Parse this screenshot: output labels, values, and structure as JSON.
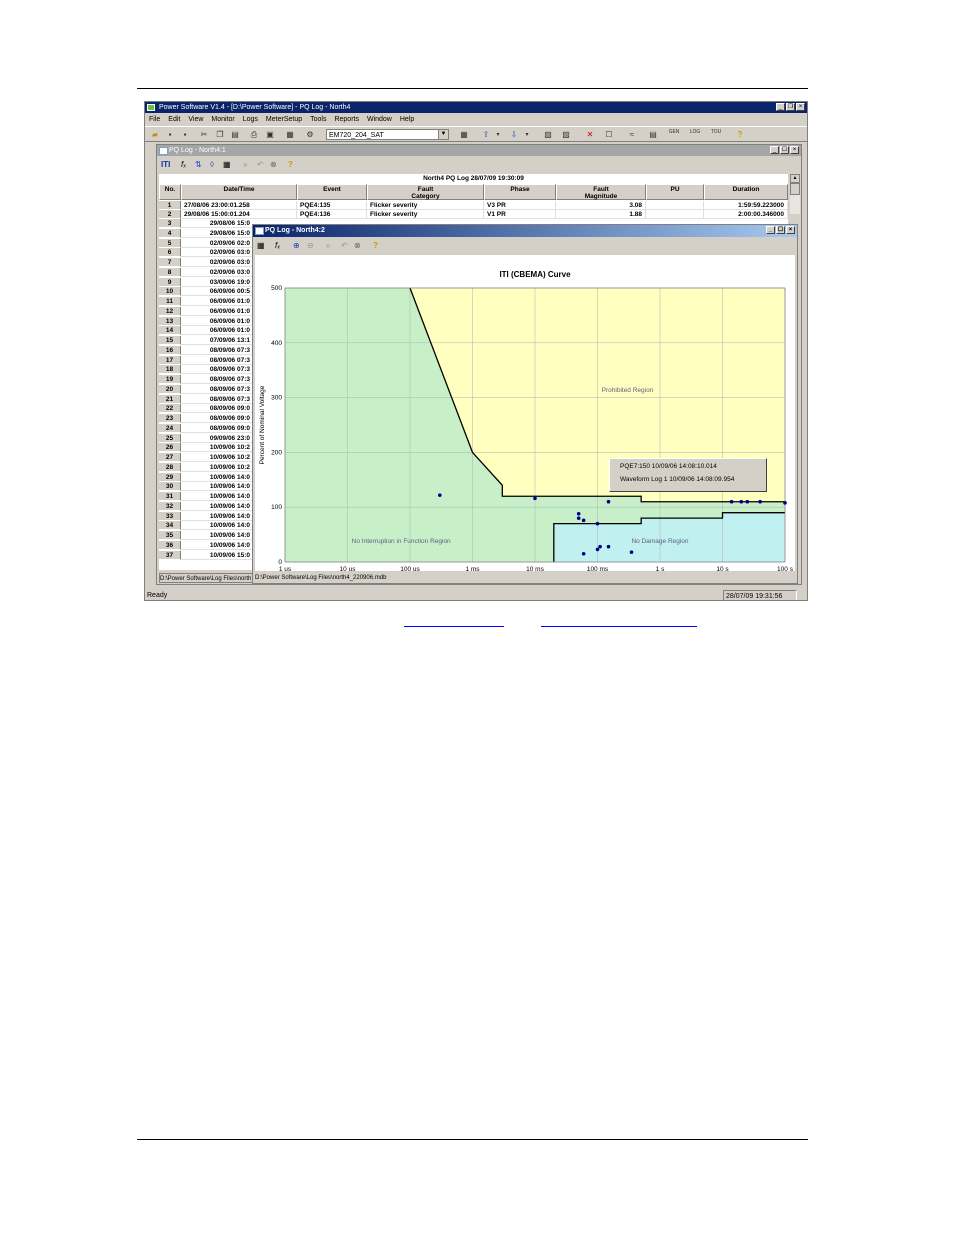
{
  "app": {
    "title": "Power Software V1.4 - [D:\\Power Software] - PQ Log - North4",
    "menu": [
      "File",
      "Edit",
      "View",
      "Monitor",
      "Logs",
      "MeterSetup",
      "Tools",
      "Reports",
      "Window",
      "Help"
    ],
    "device_combo": "EM720_204_SAT",
    "status_left": "Ready",
    "status_right": "28/07/09 19:31:56",
    "toolbar_labels": {
      "gen": "GEN",
      "log": "LOG",
      "tou": "TOU"
    }
  },
  "pq_table_window": {
    "title": "PQ Log - North4:1",
    "toolbar_iti": "ITI",
    "toolbar_fx": "fₓ",
    "table_title": "North4  PQ Log  28/07/09 19:30:09",
    "columns": [
      "No.",
      "Date/Time",
      "Event",
      "Fault\nCategory",
      "Phase",
      "Fault\nMagnitude",
      "PU",
      "Duration"
    ],
    "rows_full": [
      {
        "no": "1",
        "date": "27/08/06 23:00:01.258",
        "event": "PQE4:135",
        "category": "Flicker severity",
        "phase": "V3 PR",
        "magnitude": "3.08",
        "pu": "",
        "duration": "1:59:59.223000"
      },
      {
        "no": "2",
        "date": "29/08/06 15:00:01.204",
        "event": "PQE4:136",
        "category": "Flicker severity",
        "phase": "V1 PR",
        "magnitude": "1.88",
        "pu": "",
        "duration": "2:00:00.346000"
      }
    ],
    "rows_partial": [
      {
        "no": "3",
        "date": "29/08/06 15:0"
      },
      {
        "no": "4",
        "date": "29/08/06 15:0"
      },
      {
        "no": "5",
        "date": "02/09/06 02:0"
      },
      {
        "no": "6",
        "date": "02/09/06 03:0"
      },
      {
        "no": "7",
        "date": "02/09/06 03:0"
      },
      {
        "no": "8",
        "date": "02/09/06 03:0"
      },
      {
        "no": "9",
        "date": "03/09/06 19:0"
      },
      {
        "no": "10",
        "date": "06/09/06 00:5"
      },
      {
        "no": "11",
        "date": "06/09/06 01:0"
      },
      {
        "no": "12",
        "date": "06/09/06 01:0"
      },
      {
        "no": "13",
        "date": "06/09/06 01:0"
      },
      {
        "no": "14",
        "date": "06/09/06 01:0"
      },
      {
        "no": "15",
        "date": "07/09/06 13:1"
      },
      {
        "no": "16",
        "date": "08/09/06 07:3"
      },
      {
        "no": "17",
        "date": "08/09/06 07:3"
      },
      {
        "no": "18",
        "date": "08/09/06 07:3"
      },
      {
        "no": "19",
        "date": "08/09/06 07:3"
      },
      {
        "no": "20",
        "date": "08/09/06 07:3"
      },
      {
        "no": "21",
        "date": "08/09/06 07:3"
      },
      {
        "no": "22",
        "date": "08/09/06 09:0"
      },
      {
        "no": "23",
        "date": "08/09/06 09:0"
      },
      {
        "no": "24",
        "date": "08/09/06 09:0"
      },
      {
        "no": "25",
        "date": "09/09/06 23:0"
      },
      {
        "no": "26",
        "date": "10/09/06 10:2"
      },
      {
        "no": "27",
        "date": "10/09/06 10:2"
      },
      {
        "no": "28",
        "date": "10/09/06 10:2"
      },
      {
        "no": "29",
        "date": "10/09/06 14:0"
      },
      {
        "no": "30",
        "date": "10/09/06 14:0"
      },
      {
        "no": "31",
        "date": "10/09/06 14:0"
      },
      {
        "no": "32",
        "date": "10/09/06 14:0"
      },
      {
        "no": "33",
        "date": "10/09/06 14:0"
      },
      {
        "no": "34",
        "date": "10/09/06 14:0"
      },
      {
        "no": "35",
        "date": "10/09/06 14:0"
      },
      {
        "no": "36",
        "date": "10/09/06 14:0"
      },
      {
        "no": "37",
        "date": "10/09/06 15:0"
      }
    ],
    "status_path": "D:\\Power Software\\Log Files\\north"
  },
  "iti_window": {
    "title": "PQ Log - North4:2",
    "status_path": "D:\\Power Software\\Log Files\\north4_220906.mdb",
    "popup": [
      "PQE7:150  10/09/06  14:08:10.014",
      "Waveform Log 1  10/09/06  14:08:09.954"
    ]
  },
  "chart_data": {
    "type": "scatter",
    "title": "ITI (CBEMA) Curve",
    "xlabel": "Duration in Seconds",
    "ylabel": "Percent of Nominal Voltage",
    "x_scale": "log",
    "x_ticks": [
      "1 us",
      "10 us",
      "100 us",
      "1 ms",
      "10 ms",
      "100 ms",
      "1 s",
      "10 s",
      "100 s"
    ],
    "y_ticks": [
      "0",
      "100",
      "200",
      "300",
      "400",
      "500"
    ],
    "ylim": [
      0,
      500
    ],
    "xlim_seconds": [
      1e-06,
      100
    ],
    "grid": true,
    "regions": [
      {
        "name": "Prohibited Region",
        "color": "#ffffc0"
      },
      {
        "name": "No Interruption in Function Region",
        "color": "#c8f0c8"
      },
      {
        "name": "No Damage Region",
        "color": "#c0f0f0"
      }
    ],
    "upper_curve": [
      [
        0.0001,
        500
      ],
      [
        0.001,
        200
      ],
      [
        0.003,
        140
      ],
      [
        0.003,
        120
      ],
      [
        0.5,
        120
      ],
      [
        0.5,
        110
      ],
      [
        100,
        110
      ]
    ],
    "lower_curve": [
      [
        0.02,
        0
      ],
      [
        0.02,
        70
      ],
      [
        0.5,
        70
      ],
      [
        0.5,
        80
      ],
      [
        10,
        80
      ],
      [
        10,
        90
      ],
      [
        100,
        90
      ]
    ],
    "points": [
      [
        0.0003,
        122
      ],
      [
        0.01,
        116
      ],
      [
        0.05,
        88
      ],
      [
        0.05,
        80
      ],
      [
        0.06,
        76
      ],
      [
        0.06,
        15
      ],
      [
        0.1,
        70
      ],
      [
        0.1,
        23
      ],
      [
        0.11,
        28
      ],
      [
        0.15,
        110
      ],
      [
        0.15,
        28
      ],
      [
        0.35,
        18
      ],
      [
        14,
        110
      ],
      [
        20,
        110
      ],
      [
        25,
        110
      ],
      [
        40,
        110
      ],
      [
        100,
        108
      ]
    ]
  }
}
